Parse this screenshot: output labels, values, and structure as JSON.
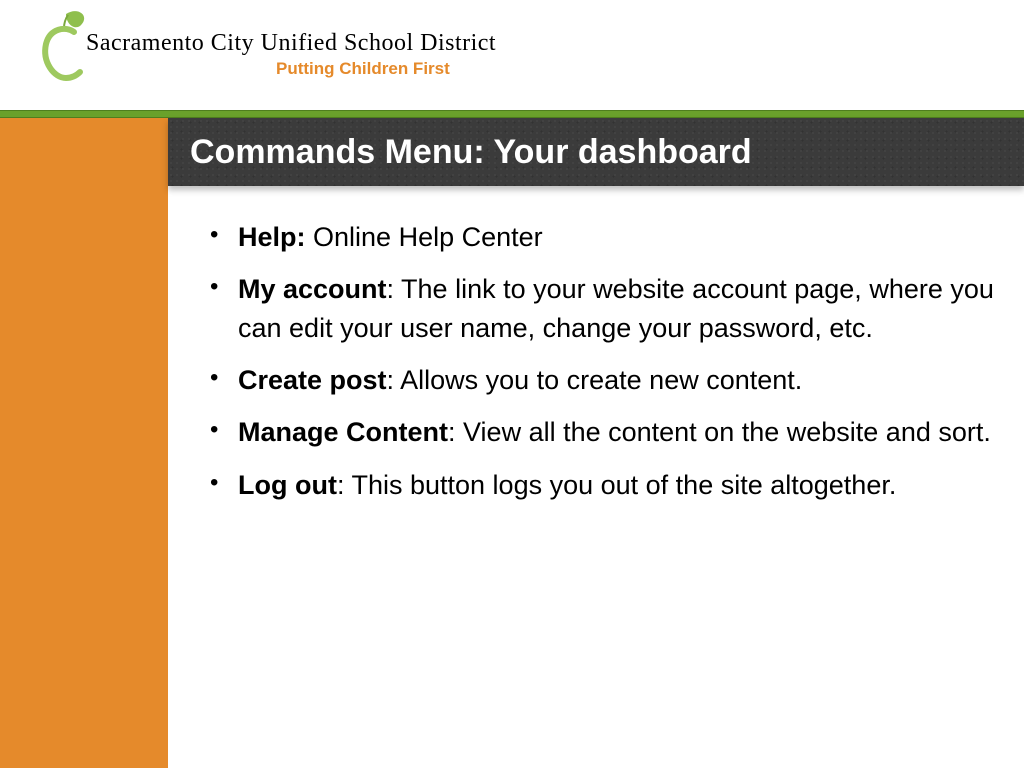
{
  "header": {
    "org_name": "Sacramento City Unified School District",
    "tagline": "Putting Children First"
  },
  "title": "Commands Menu: Your dashboard",
  "items": [
    {
      "term": "Help:",
      "sep": " ",
      "desc": "Online Help Center"
    },
    {
      "term": "My account",
      "sep": ": ",
      "desc": "The link to your website account page, where you can edit your user name, change your password, etc."
    },
    {
      "term": "Create post",
      "sep": ": ",
      "desc": "Allows you to create new content."
    },
    {
      "term": "Manage Content",
      "sep": ": ",
      "desc": "View all the content on the website and sort."
    },
    {
      "term": "Log out",
      "sep": ": ",
      "desc": "This button logs you out of the site altogether."
    }
  ]
}
